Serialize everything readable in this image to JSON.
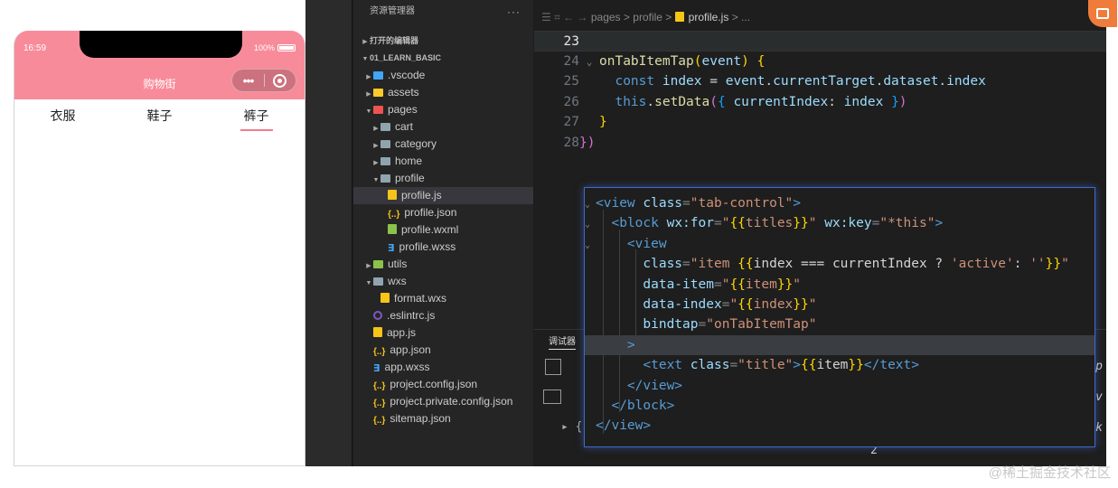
{
  "phone": {
    "time": "16:59",
    "battery": "100%",
    "nav_title": "购物街",
    "capsule_more": "•••",
    "tabs": [
      {
        "label": "衣服",
        "active": false
      },
      {
        "label": "鞋子",
        "active": false
      },
      {
        "label": "裤子",
        "active": true
      }
    ],
    "colors": {
      "nav_bg": "#f88b9a",
      "active_underline": "#f07c8d"
    }
  },
  "explorer": {
    "title": "资源管理器",
    "more": "···",
    "open_editors": "打开的编辑器",
    "root": "01_LEARN_BASIC",
    "items": [
      {
        "label": ".vscode",
        "icon": "folder-vscode-icon"
      },
      {
        "label": "assets",
        "icon": "folder-assets-icon"
      },
      {
        "label": "pages",
        "icon": "folder-pages-icon"
      },
      {
        "label": "cart",
        "icon": "folder-icon"
      },
      {
        "label": "category",
        "icon": "folder-icon"
      },
      {
        "label": "home",
        "icon": "folder-icon"
      },
      {
        "label": "profile",
        "icon": "folder-open-icon"
      },
      {
        "label": "profile.js",
        "icon": "js-file-icon",
        "selected": true
      },
      {
        "label": "profile.json",
        "icon": "json-file-icon"
      },
      {
        "label": "profile.wxml",
        "icon": "wxml-file-icon"
      },
      {
        "label": "profile.wxss",
        "icon": "css-file-icon"
      },
      {
        "label": "utils",
        "icon": "folder-utils-icon"
      },
      {
        "label": "wxs",
        "icon": "folder-open-icon"
      },
      {
        "label": "format.wxs",
        "icon": "wxs-file-icon"
      },
      {
        "label": ".eslintrc.js",
        "icon": "eslint-file-icon"
      },
      {
        "label": "app.js",
        "icon": "js-file-icon"
      },
      {
        "label": "app.json",
        "icon": "json-file-icon"
      },
      {
        "label": "app.wxss",
        "icon": "css-file-icon"
      },
      {
        "label": "project.config.json",
        "icon": "json-file-icon"
      },
      {
        "label": "project.private.config.json",
        "icon": "json-file-icon"
      },
      {
        "label": "sitemap.json",
        "icon": "json-file-icon"
      }
    ]
  },
  "breadcrumb": {
    "parts": [
      "pages",
      "profile",
      "profile.js",
      "..."
    ],
    "separator": ">"
  },
  "editor": {
    "line_numbers": [
      "23",
      "24",
      "25",
      "26",
      "27",
      "28"
    ],
    "current_line": "23",
    "lines": {
      "l24_name": "onTabItemTap",
      "l24_param": "event",
      "l25_kw": "const",
      "l25_var": "index",
      "l25_expr": "event.currentTarget.dataset.index",
      "l26_this": "this",
      "l26_fn": "setData",
      "l26_key": "currentIndex",
      "l26_val": "index"
    }
  },
  "bottom_panel": {
    "tab": "调试器",
    "line_numbers": [
      "2"
    ],
    "edge_fragments": [
      "pp",
      "ev",
      "rk"
    ]
  },
  "wxml": {
    "lines": [
      {
        "parts": [
          [
            "tag",
            "<view"
          ],
          [
            "at",
            " class"
          ],
          [
            "pu",
            "="
          ],
          [
            "st",
            "\"tab-control\""
          ],
          [
            "tag",
            ">"
          ]
        ]
      },
      {
        "parts": [
          [
            "tag",
            "<block"
          ],
          [
            "at",
            " wx:for"
          ],
          [
            "pu",
            "="
          ],
          [
            "st",
            "\""
          ],
          [
            "yb",
            "{{"
          ],
          [
            "st",
            "titles"
          ],
          [
            "yb",
            "}}"
          ],
          [
            "st",
            "\""
          ],
          [
            "at",
            " wx:key"
          ],
          [
            "pu",
            "="
          ],
          [
            "st",
            "\"*this\""
          ],
          [
            "tag",
            ">"
          ]
        ]
      },
      {
        "parts": [
          [
            "tag",
            "<view"
          ]
        ]
      },
      {
        "parts": [
          [
            "at",
            "class"
          ],
          [
            "pu",
            "="
          ],
          [
            "st",
            "\"item "
          ],
          [
            "yb",
            "{{"
          ],
          [
            "tx",
            "index === currentIndex ? "
          ],
          [
            "st",
            "'active'"
          ],
          [
            "tx",
            ": "
          ],
          [
            "st",
            "''"
          ],
          [
            "yb",
            "}}"
          ],
          [
            "st",
            "\""
          ]
        ]
      },
      {
        "parts": [
          [
            "at",
            "data-item"
          ],
          [
            "pu",
            "="
          ],
          [
            "st",
            "\""
          ],
          [
            "yb",
            "{{"
          ],
          [
            "st",
            "item"
          ],
          [
            "yb",
            "}}"
          ],
          [
            "st",
            "\""
          ]
        ]
      },
      {
        "parts": [
          [
            "at",
            "data-index"
          ],
          [
            "pu",
            "="
          ],
          [
            "st",
            "\""
          ],
          [
            "yb",
            "{{"
          ],
          [
            "st",
            "index"
          ],
          [
            "yb",
            "}}"
          ],
          [
            "st",
            "\""
          ]
        ]
      },
      {
        "parts": [
          [
            "at",
            "bindtap"
          ],
          [
            "pu",
            "="
          ],
          [
            "st",
            "\"onTabItemTap\""
          ]
        ]
      },
      {
        "parts": [
          [
            "tag",
            ">"
          ]
        ]
      },
      {
        "parts": [
          [
            "tag",
            "<text"
          ],
          [
            "at",
            " class"
          ],
          [
            "pu",
            "="
          ],
          [
            "st",
            "\"title\""
          ],
          [
            "tag",
            ">"
          ],
          [
            "yb",
            "{{"
          ],
          [
            "tx",
            "item"
          ],
          [
            "yb",
            "}}"
          ],
          [
            "tag",
            "</text>"
          ]
        ]
      },
      {
        "parts": [
          [
            "tag",
            "</view>"
          ]
        ]
      },
      {
        "parts": [
          [
            "tag",
            "</block>"
          ]
        ]
      },
      {
        "parts": [
          [
            "tag",
            "</view>"
          ]
        ]
      }
    ]
  },
  "watermark": "@稀土掘金技术社区"
}
